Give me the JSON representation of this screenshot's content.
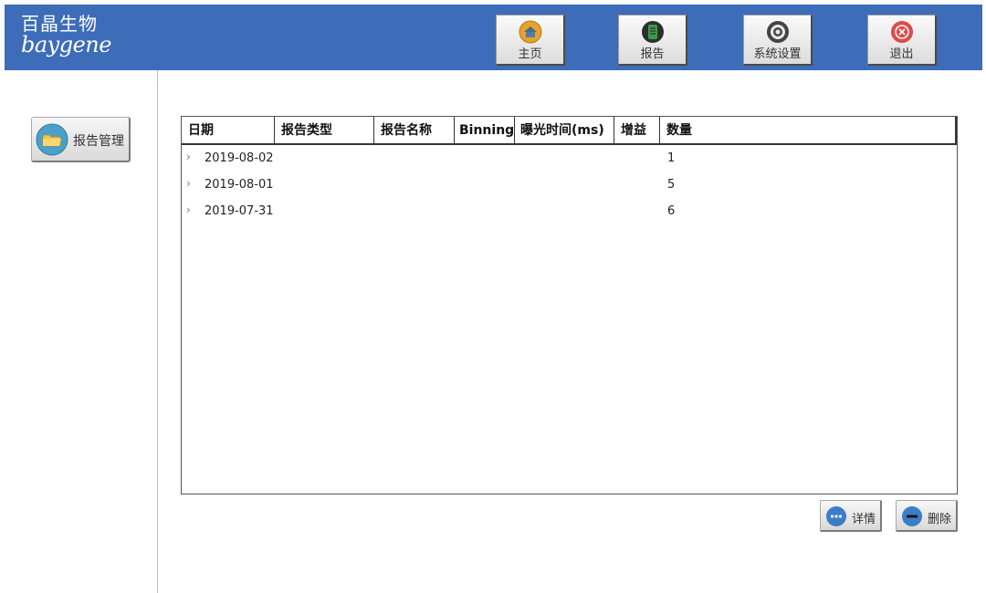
{
  "header": {
    "logo_cn": "百晶生物",
    "logo_en": "baygene",
    "nav": [
      {
        "label": "主页",
        "icon": "home-icon"
      },
      {
        "label": "报告",
        "icon": "report-icon"
      },
      {
        "label": "系统设置",
        "icon": "settings-icon"
      },
      {
        "label": "退出",
        "icon": "exit-icon"
      }
    ]
  },
  "sidebar": {
    "report_manage_label": "报告管理",
    "report_manage_icon": "folder-icon"
  },
  "table": {
    "columns": [
      "日期",
      "报告类型",
      "报告名称",
      "Binning",
      "曝光时间(ms)",
      "增益",
      "数量"
    ],
    "rows": [
      {
        "chevron": "›",
        "date": "2019-08-02",
        "count": "1"
      },
      {
        "chevron": "›",
        "date": "2019-08-01",
        "count": "5"
      },
      {
        "chevron": "›",
        "date": "2019-07-31",
        "count": "6"
      }
    ]
  },
  "actions": {
    "details_label": "详情",
    "details_icon": "more-icon",
    "delete_label": "删除",
    "delete_icon": "minus-icon"
  },
  "colors": {
    "header_bg": "#3d6db9",
    "home_icon": "#e6a32a",
    "report_icon": "#3a9b4a",
    "settings_icon": "#444444",
    "exit_icon": "#e04a4a",
    "folder_icon_bg": "#4aa0c8",
    "action_icon": "#3d7cc8"
  }
}
